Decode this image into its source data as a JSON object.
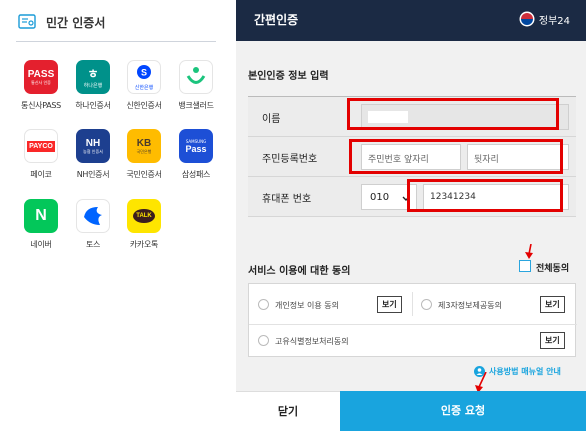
{
  "left": {
    "header_title": "민간 인증서",
    "apps": [
      {
        "label": "통신사PASS",
        "icon": "pass-app-icon",
        "logo_text": "PASS",
        "logo_sub": "통신사 인증"
      },
      {
        "label": "하나인증서",
        "icon": "hana-bank-icon",
        "logo_text": "하나은행",
        "logo_sub": ""
      },
      {
        "label": "신한인증서",
        "icon": "shinhan-bank-icon",
        "logo_text": "신한은행",
        "logo_sub": ""
      },
      {
        "label": "뱅크샐러드",
        "icon": "banksalad-icon",
        "logo_text": "",
        "logo_sub": ""
      },
      {
        "label": "페이코",
        "icon": "payco-icon",
        "logo_text": "PAYCO",
        "logo_sub": ""
      },
      {
        "label": "NH인증서",
        "icon": "nh-bank-icon",
        "logo_text": "NH",
        "logo_sub": "농협 인증서"
      },
      {
        "label": "국민인증서",
        "icon": "kb-bank-icon",
        "logo_text": "KB",
        "logo_sub": "국민은행"
      },
      {
        "label": "삼성패스",
        "icon": "samsung-pass-icon",
        "logo_text": "Pass",
        "logo_sub": "SAMSUNG"
      },
      {
        "label": "네이버",
        "icon": "naver-icon",
        "logo_text": "N",
        "logo_sub": ""
      },
      {
        "label": "토스",
        "icon": "toss-icon",
        "logo_text": "",
        "logo_sub": ""
      },
      {
        "label": "카카오톡",
        "icon": "kakaotalk-icon",
        "logo_text": "TALK",
        "logo_sub": ""
      }
    ]
  },
  "right": {
    "title": "간편인증",
    "gov_label": "정부24",
    "section_identity": "본인인증 정보 입력",
    "name_label": "이름",
    "rrn_label": "주민등록번호",
    "rrn_front_placeholder": "주민번호 앞자리",
    "rrn_back_placeholder": "뒷자리",
    "phone_label": "휴대폰 번호",
    "phone_prefix": "010",
    "phone_number": "12341234",
    "section_consent": "서비스 이용에 대한 동의",
    "agree_all": "전체동의",
    "consent_items": [
      "개인정보 이용 동의",
      "제3자정보제공동의",
      "고유식별정보처리동의"
    ],
    "view_label": "보기",
    "manual_link": "사용방법 매뉴얼 안내",
    "close_button": "닫기",
    "request_button": "인증 요청"
  },
  "colors": {
    "topbar": "#1b2a44",
    "request_button": "#19a4de",
    "highlight": "#e30000",
    "panel_bg": "#f1f1f1"
  }
}
